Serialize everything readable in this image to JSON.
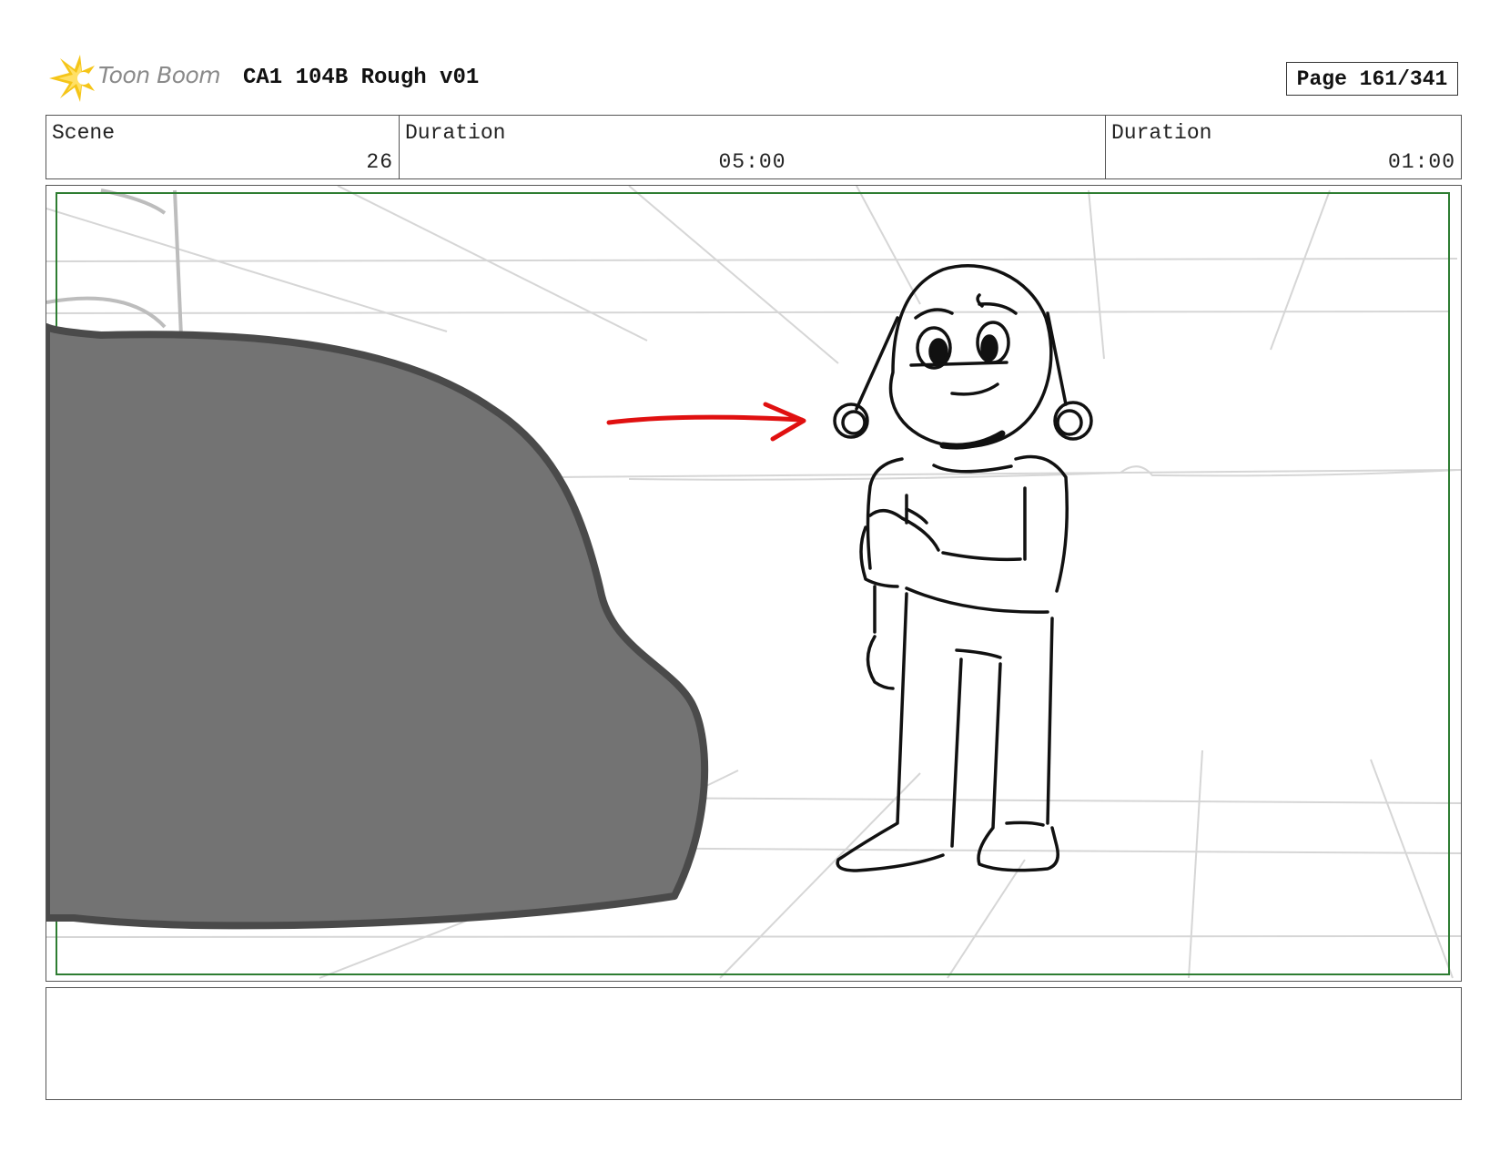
{
  "header": {
    "logo_text": "Toon Boom",
    "title": "CA1 104B Rough v01",
    "page": "Page 161/341"
  },
  "info": {
    "scene_label": "Scene",
    "scene_value": "26",
    "duration_label": "Duration",
    "duration_value": "05:00",
    "panel_duration_label": "Duration",
    "panel_duration_value": "01:00"
  },
  "notes": {
    "text": ""
  },
  "colors": {
    "safe_frame": "#2e7d32",
    "arrow": "#e01010",
    "rock_fill": "#737373",
    "rock_outline": "#4a4a4a",
    "logo_flash": "#f5c518"
  },
  "icons": {
    "logo": "toon-boom-flash-icon"
  }
}
